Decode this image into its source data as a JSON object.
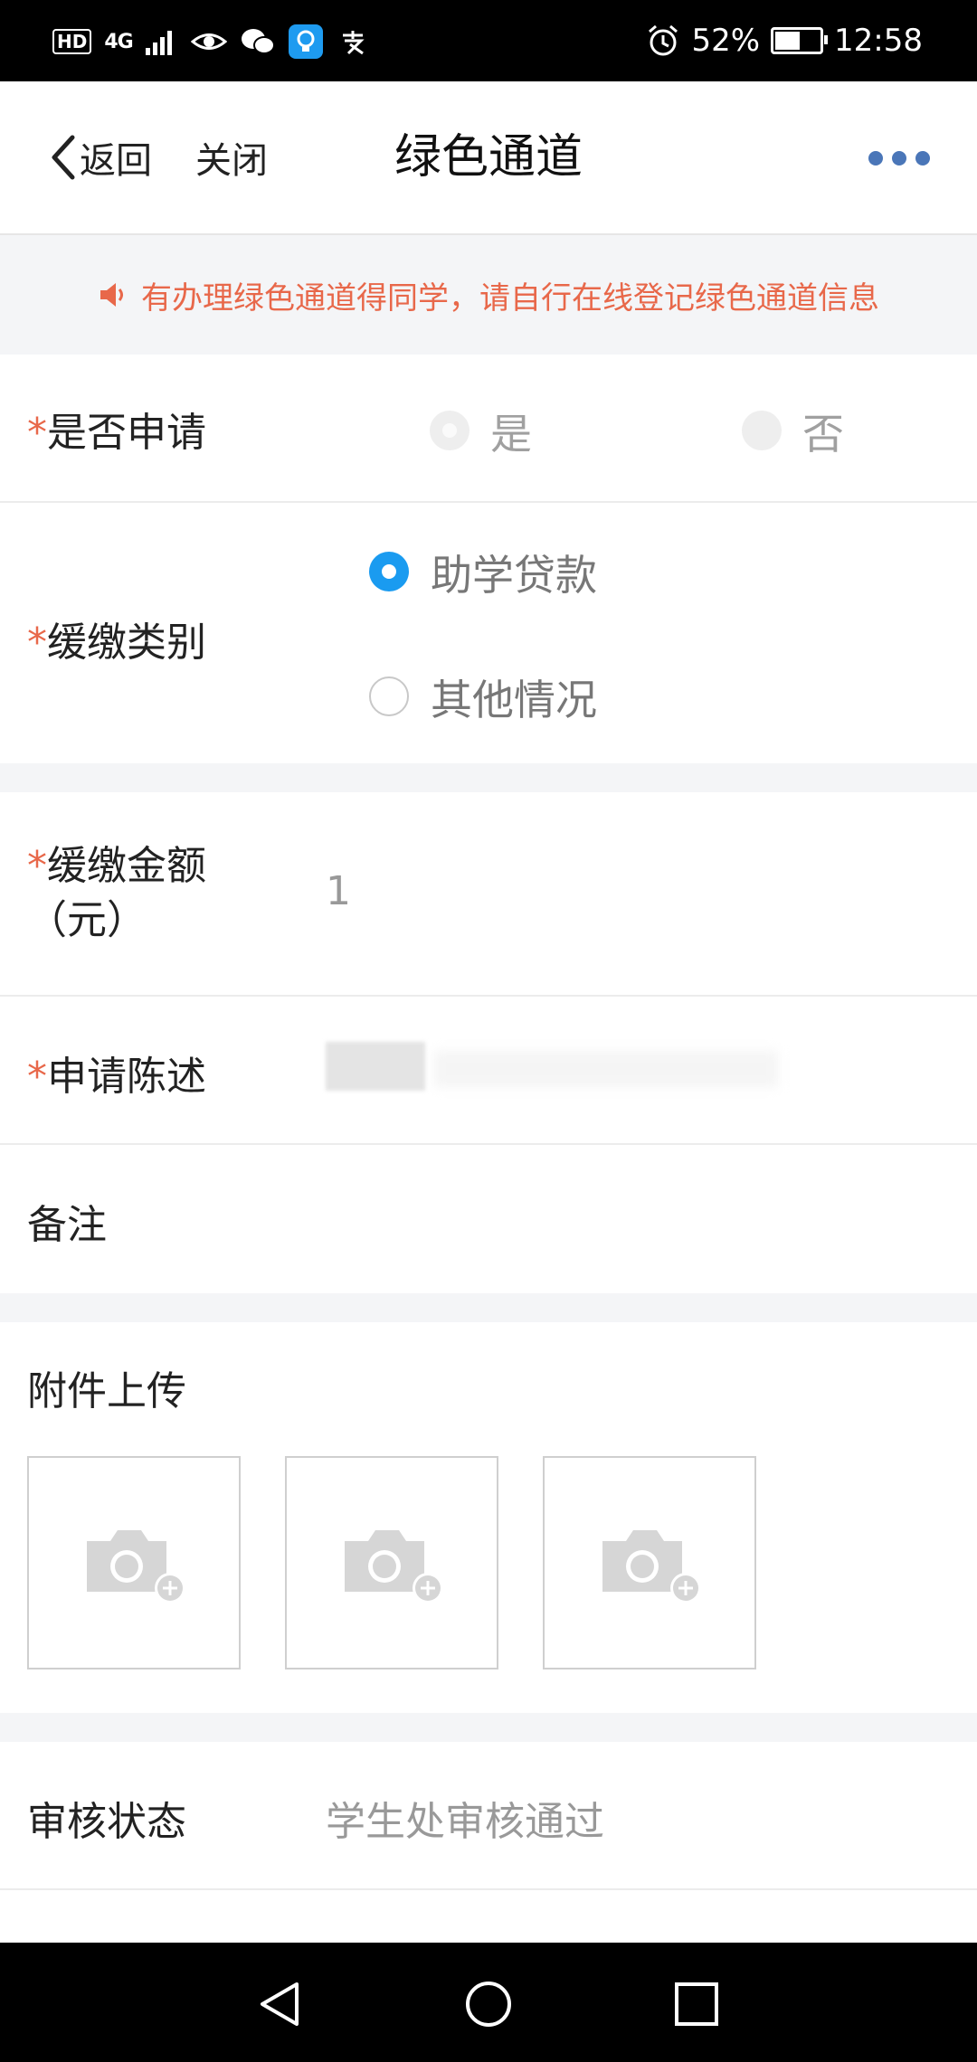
{
  "status_bar": {
    "hd": "HD",
    "network": "4G",
    "battery": "52%",
    "time": "12:58"
  },
  "nav": {
    "back_label": "返回",
    "close_label": "关闭",
    "title": "绿色通道"
  },
  "notice": {
    "text": "有办理绿色通道得同学，请自行在线登记绿色通道信息"
  },
  "form": {
    "apply": {
      "required": "*",
      "label": "是否申请",
      "options": [
        "是",
        "否"
      ]
    },
    "category": {
      "required": "*",
      "label": "缓缴类别",
      "options": [
        "助学贷款",
        "其他情况"
      ]
    },
    "amount": {
      "required": "*",
      "label_line1": "缓缴金额",
      "label_line2": "（元）",
      "value": "1"
    },
    "statement": {
      "required": "*",
      "label": "申请陈述"
    },
    "remark": {
      "label": "备注"
    },
    "attachments": {
      "label": "附件上传"
    },
    "review": {
      "label": "审核状态",
      "value": "学生处审核通过"
    }
  },
  "colors": {
    "accent": "#1a9bf0",
    "notice": "#e8684a",
    "required": "#e8684a",
    "more_dots": "#4a76b8"
  }
}
